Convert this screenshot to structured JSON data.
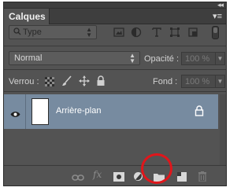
{
  "panel": {
    "collapse_glyph": "◂◂",
    "title": "Calques",
    "menu_glyph": "▾≡"
  },
  "filter": {
    "search_icon": "search-icon",
    "type_label": "Type",
    "icons": [
      "pixel-layer-filter-icon",
      "adjustment-layer-filter-icon",
      "type-layer-filter-icon",
      "shape-layer-filter-icon",
      "smart-object-filter-icon"
    ]
  },
  "blend": {
    "mode": "Normal",
    "opacity_label": "Opacité :",
    "opacity_value": "100 %"
  },
  "lock": {
    "label": "Verrou :",
    "icons": [
      "lock-transparency-icon",
      "lock-pixels-icon",
      "lock-position-icon",
      "lock-all-icon"
    ],
    "fill_label": "Fond :",
    "fill_value": "100 %"
  },
  "layers": [
    {
      "name": "Arrière-plan",
      "visible": true,
      "locked": true
    }
  ],
  "bottom_bar": {
    "icons": [
      "link-icon",
      "fx-icon",
      "mask-icon",
      "adjustment-icon",
      "new-group-folder-icon",
      "new-layer-icon",
      "trash-icon"
    ],
    "fx_label": "fx",
    "highlighted_icon": "new-group-folder-icon",
    "highlight_color": "#e0161b"
  },
  "colors": {
    "panel_bg": "#535353",
    "selected_layer": "#778ba0"
  }
}
